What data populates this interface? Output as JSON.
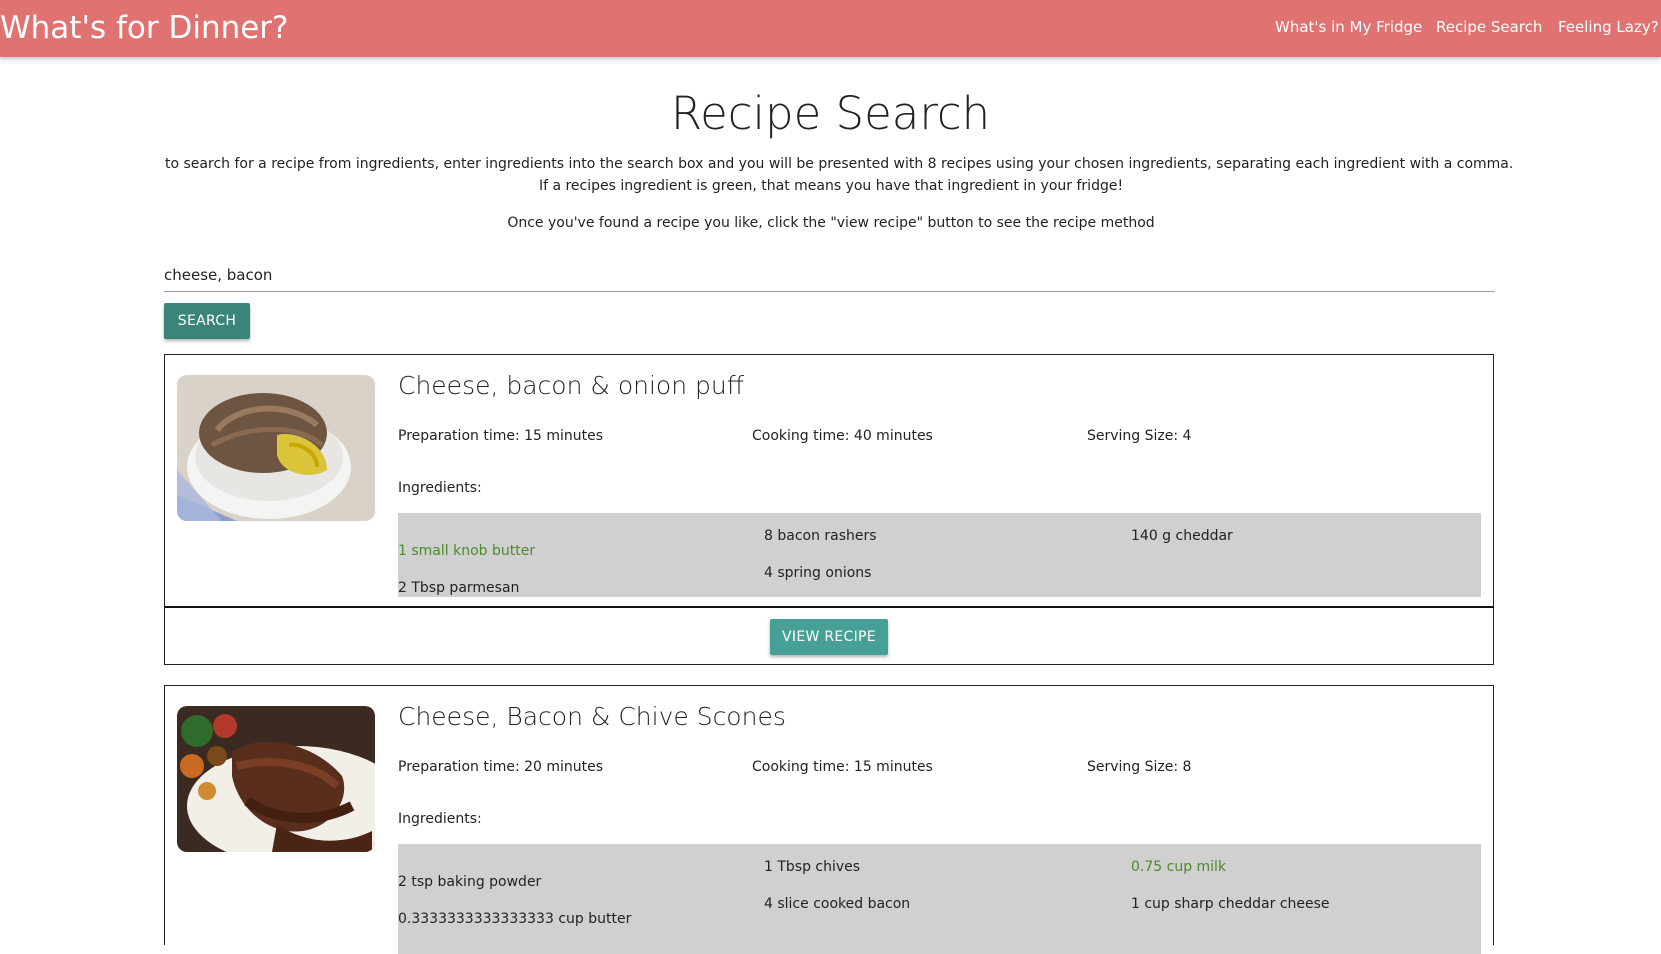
{
  "nav": {
    "brand": "What's for Dinner?",
    "links": [
      "What's in My Fridge",
      "Recipe Search",
      "Feeling Lazy?"
    ]
  },
  "page": {
    "title": "Recipe Search",
    "intro_line1": "to search for a recipe from ingredients, enter ingredients into the search box and you will be presented with 8 recipes using your chosen ingredients, separating each ingredient with a comma.",
    "intro_line2": "If a recipes ingredient is green, that means you have that ingredient in your fridge!",
    "intro_line3": "Once you've found a recipe you like, click the \"view recipe\" button to see the recipe method"
  },
  "search": {
    "value": "cheese, bacon",
    "button_label": "SEARCH"
  },
  "colors": {
    "navbar": "#e07272",
    "button": "#3b8479",
    "have_ingredient": "#4c8a2a",
    "ingredient_box": "#d0d0d0"
  },
  "recipes": [
    {
      "title": "Cheese, bacon & onion puff",
      "prep": "Preparation time: 15 minutes",
      "cook": "Cooking time: 40 minutes",
      "serving": "Serving Size: 4",
      "ingredients_label": "Ingredients:",
      "ingredients": [
        {
          "text": "1 small knob butter",
          "have": true
        },
        {
          "text": "2 Tbsp parmesan",
          "have": false
        },
        {
          "text": "8 bacon rashers",
          "have": false
        },
        {
          "text": "4 spring onions",
          "have": false
        },
        {
          "text": "140 g cheddar",
          "have": false
        }
      ],
      "button_label": "VIEW RECIPE"
    },
    {
      "title": "Cheese, Bacon & Chive Scones",
      "prep": "Preparation time: 20 minutes",
      "cook": "Cooking time: 15 minutes",
      "serving": "Serving Size: 8",
      "ingredients_label": "Ingredients:",
      "ingredients": [
        {
          "text": "2 tsp baking powder",
          "have": false
        },
        {
          "text": "0.3333333333333333 cup butter",
          "have": false
        },
        {
          "text": "1 Tbsp chives",
          "have": false
        },
        {
          "text": "4 slice cooked bacon",
          "have": false
        },
        {
          "text": "0.75 cup milk",
          "have": true
        },
        {
          "text": "1 cup sharp cheddar cheese",
          "have": false
        }
      ]
    }
  ]
}
